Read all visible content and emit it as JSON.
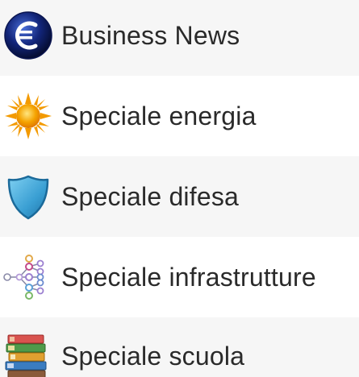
{
  "menu": {
    "items": [
      {
        "label": "Business News",
        "icon": "euro-icon"
      },
      {
        "label": "Speciale energia",
        "icon": "sun-icon"
      },
      {
        "label": "Speciale difesa",
        "icon": "shield-icon"
      },
      {
        "label": "Speciale infrastrutture",
        "icon": "network-icon"
      },
      {
        "label": "Speciale scuola",
        "icon": "books-icon"
      }
    ]
  },
  "colors": {
    "row_alt": "#f6f6f6",
    "row_plain": "#ffffff",
    "text": "#2a2a2a",
    "euro_blue": "#12257a",
    "sun_orange": "#f5a300",
    "shield_blue": "#4aa7d6",
    "network_purple": "#9b7fd0"
  }
}
